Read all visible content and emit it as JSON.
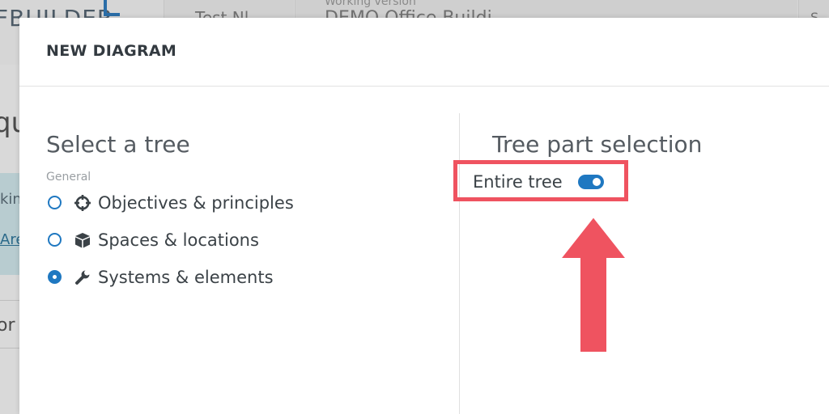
{
  "background": {
    "logo_text": "FBUILDER",
    "tab1_text": "Test Nl",
    "tab2_label": "Working version",
    "tab2_value": "DEMO Office Buildi",
    "tab3_text": "S",
    "heading": "qu",
    "box_text1": "kin",
    "box_text2": "Are",
    "or_text": "or"
  },
  "modal": {
    "title": "NEW DIAGRAM",
    "left": {
      "title": "Select a tree",
      "group_label": "General",
      "options": [
        {
          "label": "Objectives & principles",
          "icon": "crosshair-icon",
          "checked": false
        },
        {
          "label": "Spaces & locations",
          "icon": "cube-icon",
          "checked": false
        },
        {
          "label": "Systems & elements",
          "icon": "wrench-icon",
          "checked": true
        }
      ]
    },
    "right": {
      "title": "Tree part selection",
      "toggle_label": "Entire tree",
      "toggle_on": true
    }
  },
  "colors": {
    "accent": "#1f78c1",
    "annotation": "#ef5360"
  }
}
